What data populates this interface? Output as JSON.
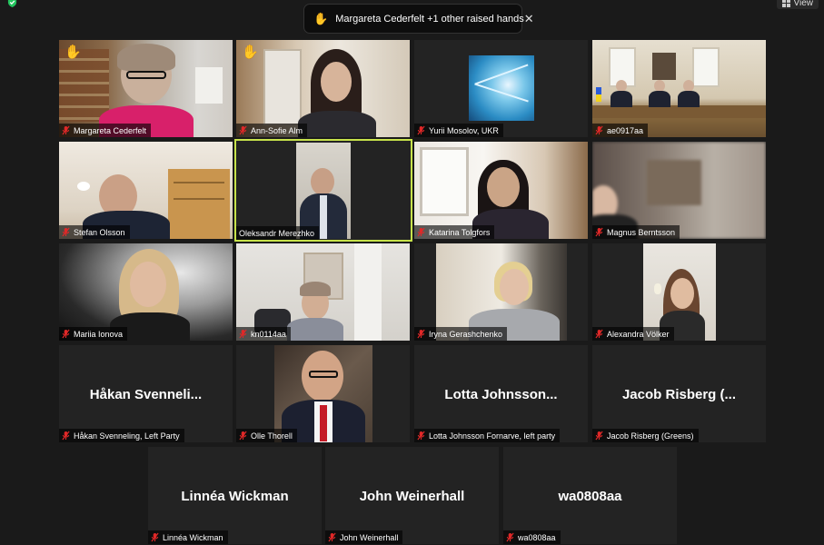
{
  "header": {
    "view_label": "View"
  },
  "notification": {
    "message": "Margareta Cederfelt +1 other raised hands",
    "close_symbol": "✕",
    "hand_symbol": "✋"
  },
  "participants": [
    {
      "name": "Margareta Cederfelt",
      "raised_hand": true
    },
    {
      "name": "Ann-Sofie Alm",
      "raised_hand": true
    },
    {
      "name": "Yurii Mosolov, UKR"
    },
    {
      "name": "ae0917aa"
    },
    {
      "name": "Stefan Olsson"
    },
    {
      "name": "Oleksandr Merezhko",
      "active_speaker": true
    },
    {
      "name": "Katarina Tolgfors"
    },
    {
      "name": "Magnus Berntsson"
    },
    {
      "name": "Mariia Ionova"
    },
    {
      "name": "kn0114aa"
    },
    {
      "name": "Iryna Gerashchenko"
    },
    {
      "name": "Alexandra Völker"
    },
    {
      "name": "Håkan Svenneling, Left Party",
      "display": "Håkan Svenneli..."
    },
    {
      "name": "Olle Thorell"
    },
    {
      "name": "Lotta Johnsson Fornarve, left party",
      "display": "Lotta Johnsson..."
    },
    {
      "name": "Jacob Risberg (Greens)",
      "display": "Jacob Risberg (..."
    },
    {
      "name": "Linnéa Wickman",
      "display": "Linnéa Wickman"
    },
    {
      "name": "John Weinerhall",
      "display": "John Weinerhall"
    },
    {
      "name": "wa0808aa",
      "display": "wa0808aa"
    }
  ]
}
